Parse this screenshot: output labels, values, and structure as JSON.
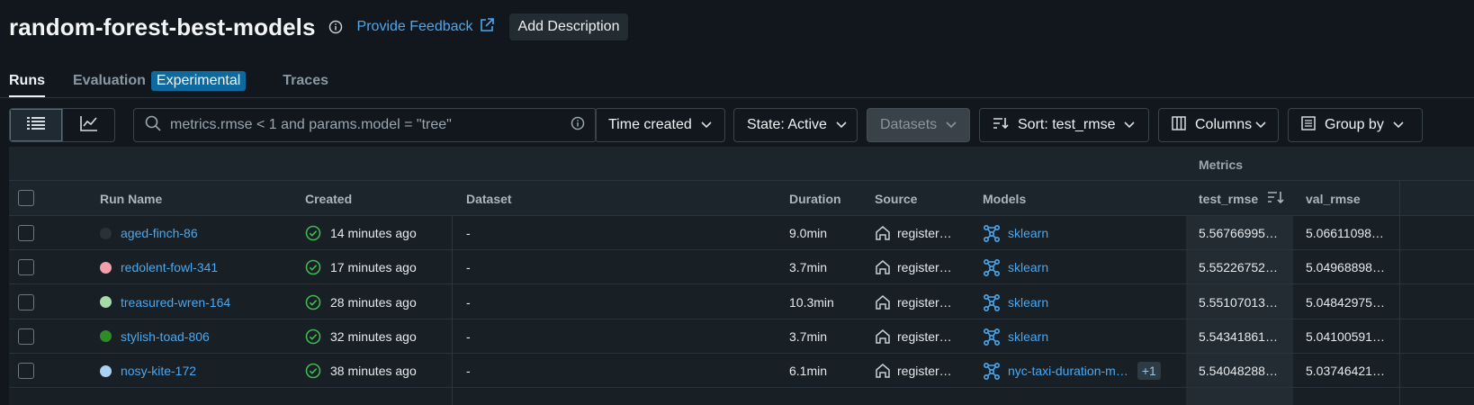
{
  "header": {
    "title": "random-forest-best-models",
    "feedback_label": "Provide Feedback",
    "add_description_label": "Add Description"
  },
  "tabs": [
    {
      "label": "Runs",
      "active": true
    },
    {
      "label": "Evaluation",
      "badge": "Experimental"
    },
    {
      "label": "Traces"
    }
  ],
  "toolbar": {
    "search_value": "metrics.rmse < 1 and params.model = \"tree\"",
    "time_created_label": "Time created",
    "state_label": "State: Active",
    "datasets_label": "Datasets",
    "sort_label": "Sort: test_rmse",
    "columns_label": "Columns",
    "group_by_label": "Group by"
  },
  "table": {
    "group_label": "Metrics",
    "columns": [
      "Run Name",
      "Created",
      "Dataset",
      "Duration",
      "Source",
      "Models",
      "test_rmse",
      "val_rmse"
    ],
    "rows": [
      {
        "name": "aged-finch-86",
        "color": "#2a3138",
        "created": "14 minutes ago",
        "dataset": "-",
        "duration": "9.0min",
        "source": "register…",
        "model": "sklearn",
        "extra": "",
        "test_rmse": "5.56766995…",
        "val_rmse": "5.06611098…"
      },
      {
        "name": "redolent-fowl-341",
        "color": "#f2a0ac",
        "created": "17 minutes ago",
        "dataset": "-",
        "duration": "3.7min",
        "source": "register…",
        "model": "sklearn",
        "extra": "",
        "test_rmse": "5.55226752…",
        "val_rmse": "5.04968898…"
      },
      {
        "name": "treasured-wren-164",
        "color": "#a6dba8",
        "created": "28 minutes ago",
        "dataset": "-",
        "duration": "10.3min",
        "source": "register…",
        "model": "sklearn",
        "extra": "",
        "test_rmse": "5.55107013…",
        "val_rmse": "5.04842975…"
      },
      {
        "name": "stylish-toad-806",
        "color": "#2f8a2a",
        "created": "32 minutes ago",
        "dataset": "-",
        "duration": "3.7min",
        "source": "register…",
        "model": "sklearn",
        "extra": "",
        "test_rmse": "5.54341861…",
        "val_rmse": "5.04100591…"
      },
      {
        "name": "nosy-kite-172",
        "color": "#a9d3f5",
        "created": "38 minutes ago",
        "dataset": "-",
        "duration": "6.1min",
        "source": "register…",
        "model": "nyc-taxi-duration-m…",
        "extra": "+1",
        "test_rmse": "5.54048288…",
        "val_rmse": "5.03746421…"
      }
    ]
  },
  "colors": {
    "accent": "#4aa8f0",
    "success": "#3fb950",
    "background": "#11171c"
  }
}
